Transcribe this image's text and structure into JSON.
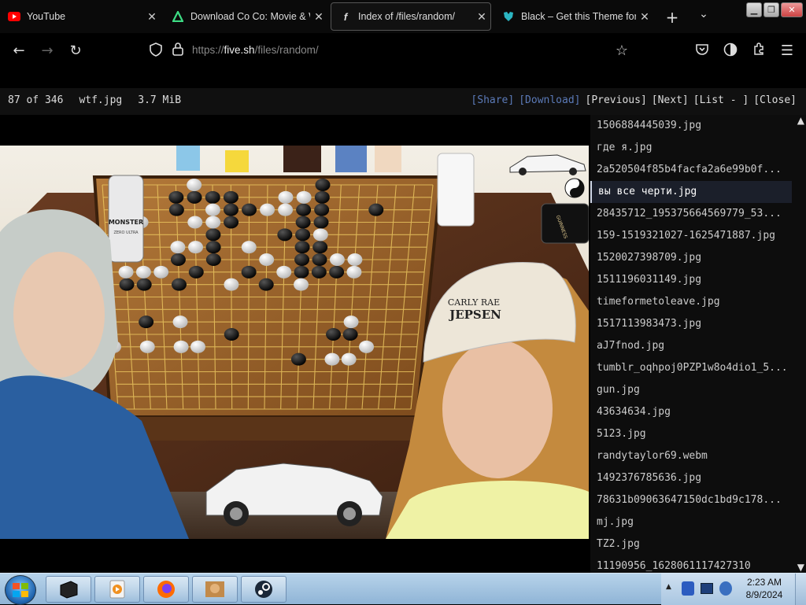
{
  "tabs": [
    {
      "title": "YouTube",
      "favicon": "youtube-icon",
      "active": false
    },
    {
      "title": "Download Co Co: Movie & W",
      "favicon": "download-icon",
      "active": false
    },
    {
      "title": "Index of /files/random/",
      "favicon": "five-sh-icon",
      "active": true
    },
    {
      "title": "Black – Get this Theme for 🦊",
      "favicon": "theme-icon",
      "active": false
    }
  ],
  "nav": {
    "url_scheme": "https://",
    "url_host": "five.sh",
    "url_path": "/files/random/"
  },
  "viewer": {
    "position": "87 of 346",
    "filename": "wtf.jpg",
    "size": "3.7 MiB",
    "share": "[Share]",
    "download": "[Download]",
    "previous": "[Previous]",
    "next": "[Next]",
    "list": "[List - ]",
    "close": "[Close]"
  },
  "files": [
    "1506884445039.jpg",
    "где я.jpg",
    "2a520504f85b4facfa2a6e99b0f...",
    "вы все черти.jpg",
    "28435712_195375664569779_53...",
    "159-1519321027-1625471887.jpg",
    "1520027398709.jpg",
    "1511196031149.jpg",
    "timeformetoleave.jpg",
    "1517113983473.jpg",
    "aJ7fnod.jpg",
    "tumblr_oqhpoj0PZP1w8o4dio1_5...",
    "gun.jpg",
    "43634634.jpg",
    "5123.jpg",
    "randytaylor69.webm",
    "1492376785636.jpg",
    "78631b09063647150dc1bd9c178...",
    "mj.jpg",
    "TZ2.jpg",
    "11190956_1628061117427310"
  ],
  "selected_file_index": 3,
  "image": {
    "cap_text_line1": "CARLY RAE",
    "cap_text_line2": "JEPSEN",
    "can_text": "MONSTER",
    "can_subtext": "ZERO ULTRA",
    "guinness_text": "GUINNESS"
  },
  "taskbar": {
    "time": "2:23 AM",
    "date": "8/9/2024"
  },
  "colors": {
    "link": "#5b7ab8",
    "selected_bg": "#1b1f2a",
    "board": "#a86a2c"
  }
}
